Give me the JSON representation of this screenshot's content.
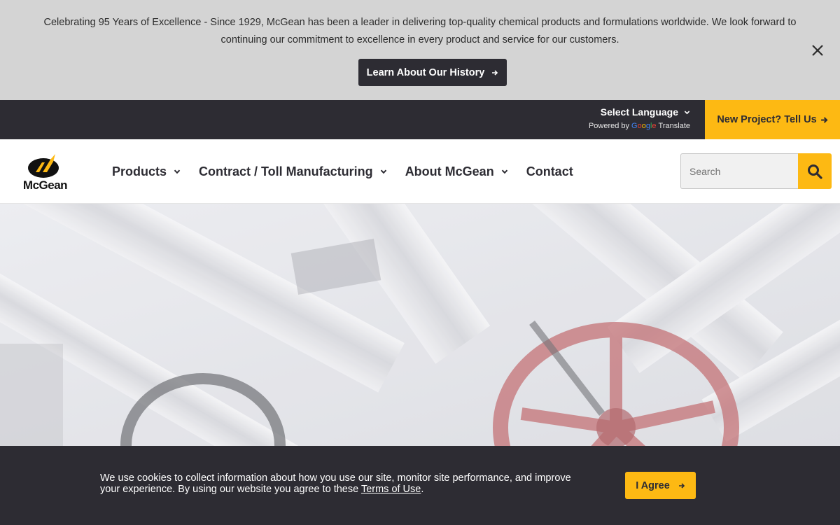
{
  "announcement": {
    "text": "Celebrating 95 Years of Excellence - Since 1929, McGean has been a leader in delivering top-quality chemical products and formulations worldwide. We look forward to continuing our commitment to excellence in every product and service for our customers.",
    "button_label": "Learn About Our History",
    "close_icon": "close-icon"
  },
  "utility_bar": {
    "language_label": "Select Language",
    "powered_by": "Powered by",
    "google": [
      "G",
      "o",
      "o",
      "g",
      "l",
      "e"
    ],
    "translate": "Translate",
    "cta_label": "New Project? Tell Us"
  },
  "header": {
    "logo_text": "McGean",
    "nav": [
      {
        "label": "Products",
        "has_dropdown": true
      },
      {
        "label": "Contract / Toll Manufacturing",
        "has_dropdown": true
      },
      {
        "label": "About McGean",
        "has_dropdown": true
      },
      {
        "label": "Contact",
        "has_dropdown": false
      }
    ],
    "search_placeholder": "Search"
  },
  "cookie": {
    "text": "We use cookies to collect information about how you use our site, monitor site performance, and improve your experience. By using our website you agree to these ",
    "link": "Terms of Use",
    "end": ".",
    "button_label": "I Agree"
  },
  "colors": {
    "accent": "#fdb913",
    "dark": "#2d2c33",
    "announcement_bg": "#d4d4d4"
  }
}
